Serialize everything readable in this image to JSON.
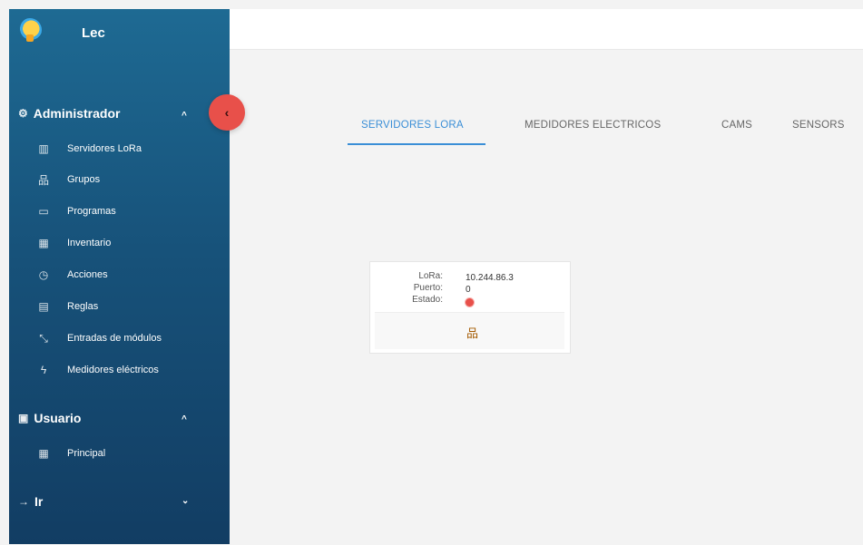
{
  "app": {
    "brand": "Lec"
  },
  "sidebar": {
    "admin": {
      "label": "Administrador",
      "items": [
        {
          "label": "Servidores LoRa",
          "icon": "chart-icon"
        },
        {
          "label": "Grupos",
          "icon": "network-icon"
        },
        {
          "label": "Programas",
          "icon": "calendar-icon"
        },
        {
          "label": "Inventario",
          "icon": "table-icon"
        },
        {
          "label": "Acciones",
          "icon": "clock-icon"
        },
        {
          "label": "Reglas",
          "icon": "ruler-icon"
        },
        {
          "label": "Entradas de módulos",
          "icon": "expand-icon"
        },
        {
          "label": "Medidores eléctricos",
          "icon": "bolt-icon"
        }
      ]
    },
    "user": {
      "label": "Usuario",
      "items": [
        {
          "label": "Principal",
          "icon": "grid-icon"
        }
      ]
    },
    "go": {
      "label": "Ir"
    }
  },
  "tabs": [
    {
      "label": "SERVIDORES LORA",
      "active": true
    },
    {
      "label": "MEDIDORES ELECTRICOS",
      "active": false
    },
    {
      "label": "CAMS",
      "active": false
    },
    {
      "label": "SENSORS",
      "active": false
    }
  ],
  "server_card": {
    "lora_label": "LoRa:",
    "lora_value": "10.244.86.3",
    "port_label": "Puerto:",
    "port_value": "0",
    "status_label": "Estado:",
    "status_color": "#e8504a"
  },
  "colors": {
    "sidebar_top": "#1e6a93",
    "sidebar_bottom": "#123d63",
    "accent": "#3a8ed6",
    "danger": "#e8504a"
  }
}
